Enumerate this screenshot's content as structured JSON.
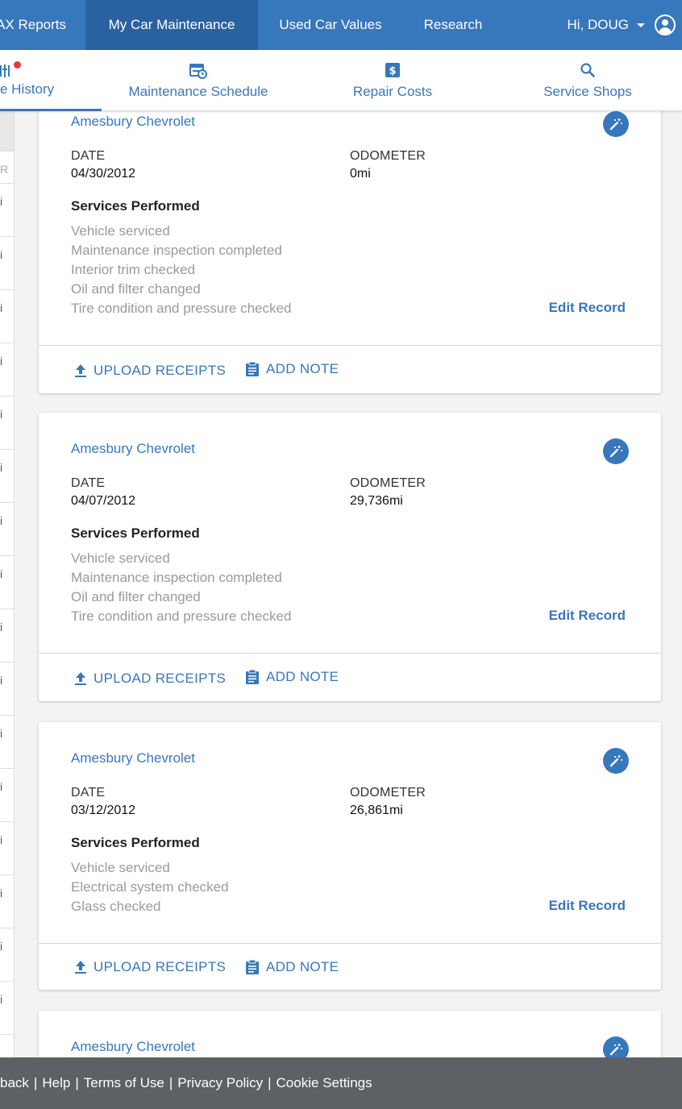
{
  "topnav": {
    "items": [
      {
        "label": "AX Reports"
      },
      {
        "label": "My Car Maintenance"
      },
      {
        "label": "Used Car Values"
      },
      {
        "label": "Research"
      }
    ],
    "user_greeting": "Hi, DOUG"
  },
  "subnav": {
    "tabs": [
      {
        "label": "e History",
        "icon": "service-history-icon"
      },
      {
        "label": "Maintenance Schedule",
        "icon": "schedule-icon"
      },
      {
        "label": "Repair Costs",
        "icon": "dollar-icon"
      },
      {
        "label": "Service Shops",
        "icon": "search-icon"
      }
    ]
  },
  "leftstrip": {
    "header": "R",
    "rows": [
      "i",
      "i",
      "i",
      "i",
      "i",
      "i",
      "i",
      "i",
      "i",
      "i",
      "i",
      "i",
      "i",
      "i",
      "i",
      "i"
    ]
  },
  "labels": {
    "date": "DATE",
    "odometer": "ODOMETER",
    "services": "Services Performed",
    "edit": "Edit Record",
    "upload": "UPLOAD RECEIPTS",
    "note": "ADD NOTE"
  },
  "records": [
    {
      "shop": "Amesbury Chevrolet",
      "date": "04/30/2012",
      "odometer": "0mi",
      "services": [
        "Vehicle serviced",
        "Maintenance inspection completed",
        "Interior trim checked",
        "Oil and filter changed",
        "Tire condition and pressure checked"
      ]
    },
    {
      "shop": "Amesbury Chevrolet",
      "date": "04/07/2012",
      "odometer": "29,736mi",
      "services": [
        "Vehicle serviced",
        "Maintenance inspection completed",
        "Oil and filter changed",
        "Tire condition and pressure checked"
      ]
    },
    {
      "shop": "Amesbury Chevrolet",
      "date": "03/12/2012",
      "odometer": "26,861mi",
      "services": [
        "Vehicle serviced",
        "Electrical system checked",
        "Glass checked"
      ]
    },
    {
      "shop": "Amesbury Chevrolet"
    }
  ],
  "footer": {
    "links": [
      "back",
      "Help",
      "Terms of Use",
      "Privacy Policy",
      "Cookie Settings"
    ]
  },
  "colors": {
    "brand": "#3777bc",
    "brand_dark": "#2a61a0",
    "footer": "#5d6064",
    "alert": "#e53935"
  }
}
